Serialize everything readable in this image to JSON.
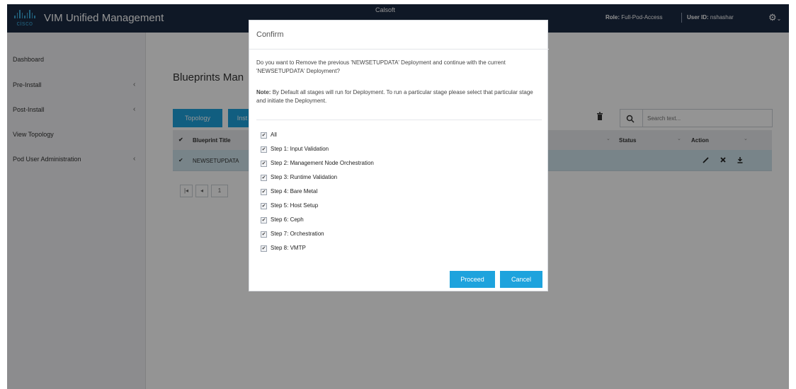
{
  "header": {
    "logo_text": "cisco",
    "app_title": "VIM Unified Management",
    "tenant": "Calsoft",
    "role_label": "Role:",
    "role_value": "Full-Pod-Access",
    "user_label": "User ID:",
    "user_value": "nshashar",
    "settings_icon": "gear-icon"
  },
  "sidebar": {
    "items": [
      {
        "label": "Dashboard",
        "chevron": ""
      },
      {
        "label": "Pre-Install",
        "chevron": "‹"
      },
      {
        "label": "Post-Install",
        "chevron": "‹"
      },
      {
        "label": "View Topology",
        "chevron": ""
      },
      {
        "label": "Pod User Administration",
        "chevron": "‹"
      }
    ]
  },
  "main": {
    "page_title": "Blueprints Man",
    "tabs": [
      {
        "label": "Topology"
      },
      {
        "label": "Inst"
      }
    ],
    "search_placeholder": "Search text...",
    "table": {
      "header_check": "✔",
      "columns": [
        "Blueprint Title",
        "Status",
        "Action"
      ],
      "rows": [
        {
          "check": "✔",
          "title": "NEWSETUPDATA"
        }
      ]
    },
    "pager": {
      "first": "|◂",
      "prev": "◂",
      "page": "1"
    }
  },
  "modal": {
    "title": "Confirm",
    "message": "Do you want to Remove the previous 'NEWSETUPDATA' Deployment and continue with the current 'NEWSETUPDATA' Deployment?",
    "note_label": "Note:",
    "note_text": "By Default all stages will run for Deployment. To run a particular stage please select that particular stage and initiate the Deployment.",
    "stages": [
      {
        "label": "All",
        "checked": true
      },
      {
        "label": "Step 1: Input Validation",
        "checked": true
      },
      {
        "label": "Step 2: Management Node Orchestration",
        "checked": true
      },
      {
        "label": "Step 3: Runtime Validation",
        "checked": true
      },
      {
        "label": "Step 4: Bare Metal",
        "checked": true
      },
      {
        "label": "Step 5: Host Setup",
        "checked": true
      },
      {
        "label": "Step 6: Ceph",
        "checked": true
      },
      {
        "label": "Step 7: Orchestration",
        "checked": true
      },
      {
        "label": "Step 8: VMTP",
        "checked": true
      }
    ],
    "check_glyph": "✔",
    "proceed_label": "Proceed",
    "cancel_label": "Cancel"
  },
  "colors": {
    "header_bg": "#1b2a42",
    "accent": "#1ea3dd",
    "selected_row": "#cfe4ec"
  }
}
